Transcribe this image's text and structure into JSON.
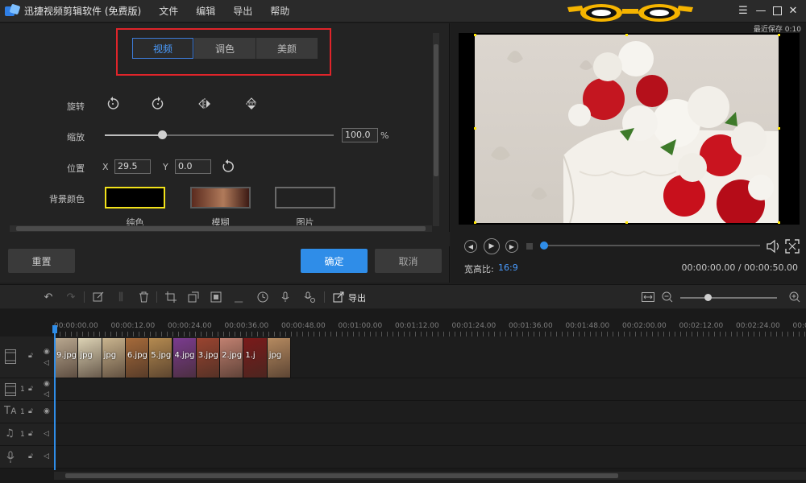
{
  "titlebar": {
    "app_title": "迅捷视频剪辑软件 (免费版)",
    "menus": [
      "文件",
      "编辑",
      "导出",
      "帮助"
    ]
  },
  "edit_panel": {
    "tabs": [
      {
        "label": "视频",
        "active": true
      },
      {
        "label": "调色",
        "active": false
      },
      {
        "label": "美颜",
        "active": false
      }
    ],
    "rotate_label": "旋转",
    "scale_label": "缩放",
    "scale_value": "100.0",
    "scale_unit": "%",
    "scale_level": 0.25,
    "position_label": "位置",
    "pos_x_label": "X",
    "pos_x_value": "29.5",
    "pos_y_label": "Y",
    "pos_y_value": "0.0",
    "bg_color_label": "背景颜色",
    "bg_options": [
      "纯色",
      "模糊",
      "图片"
    ],
    "reset_label": "重置",
    "ok_label": "确定",
    "cancel_label": "取消"
  },
  "preview": {
    "autosave": "最近保存 0:10",
    "aspect_label": "宽高比:",
    "aspect_value": "16:9",
    "time": "00:00:00.00 / 00:00:50.00",
    "progress": 0
  },
  "toolbar": {
    "export_label": "导出",
    "zoom_level": 0.25
  },
  "timeline": {
    "ruler": [
      "00:00:00.00",
      "00:00:12.00",
      "00:00:24.00",
      "00:00:36.00",
      "00:00:48.00",
      "00:01:00.00",
      "00:01:12.00",
      "00:01:24.00",
      "00:01:36.00",
      "00:01:48.00",
      "00:02:00.00",
      "00:02:12.00",
      "00:02:24.00",
      "00:0"
    ],
    "clips": [
      {
        "label": "9.jpg",
        "color": "#b8a78f"
      },
      {
        "label": "jpg",
        "color": "#dcd2b4"
      },
      {
        "label": "jpg",
        "color": "#c9b48e"
      },
      {
        "label": "6.jpg",
        "color": "#a56a3a"
      },
      {
        "label": "5.jpg",
        "color": "#b48a50"
      },
      {
        "label": "4.jpg",
        "color": "#7a3b8f"
      },
      {
        "label": "3.jpg",
        "color": "#9a4430"
      },
      {
        "label": "2.jpg",
        "color": "#c08070"
      },
      {
        "label": "1.j",
        "color": "#7a1a1a"
      },
      {
        "label": "jpg",
        "color": "#b58a60"
      }
    ],
    "track_nums": [
      "1",
      "1",
      "1",
      "1"
    ]
  },
  "colors": {
    "accent": "#2f8de8",
    "highlight_box": "#e0242a",
    "swatch_solid_border": "#f2e21a"
  }
}
